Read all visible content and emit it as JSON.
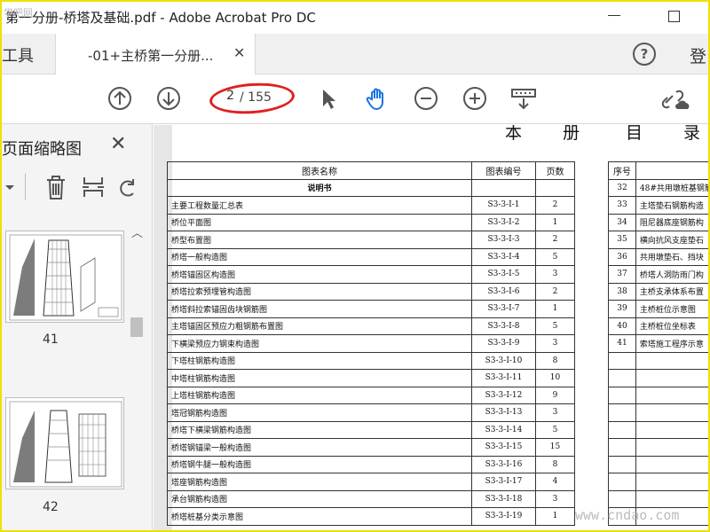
{
  "window": {
    "title": "第一分册-桥塔及基础.pdf - Adobe Acrobat Pro DC",
    "watermark_top": "学吧网"
  },
  "tabs": {
    "tools_label": "工具",
    "doc_tab_label": "-01+主桥第一分册...",
    "signin_label": "登"
  },
  "toolbar": {
    "current_page": "2",
    "total_pages": "/ 155"
  },
  "sidebar": {
    "title": "页面缩略图",
    "thumbnails": [
      {
        "number": "41"
      },
      {
        "number": "42"
      }
    ]
  },
  "document": {
    "heading_chars": [
      "本",
      "册",
      "目",
      "录"
    ],
    "left_table": {
      "headers": [
        "图表名称",
        "图表编号",
        "页数"
      ],
      "section_label": "说明书",
      "rows": [
        [
          "主要工程数量汇总表",
          "S3-3-Ⅰ-1",
          "2"
        ],
        [
          "桥位平面图",
          "S3-3-Ⅰ-2",
          "1"
        ],
        [
          "桥型布置图",
          "S3-3-Ⅰ-3",
          "2"
        ],
        [
          "桥塔一般构造图",
          "S3-3-Ⅰ-4",
          "5"
        ],
        [
          "桥塔锚固区构造图",
          "S3-3-Ⅰ-5",
          "3"
        ],
        [
          "桥塔拉索预埋管构造图",
          "S3-3-Ⅰ-6",
          "2"
        ],
        [
          "桥塔斜拉索锚固齿块钢筋图",
          "S3-3-Ⅰ-7",
          "1"
        ],
        [
          "主塔锚固区预应力粗钢筋布置图",
          "S3-3-Ⅰ-8",
          "5"
        ],
        [
          "下横梁预应力钢束构造图",
          "S3-3-Ⅰ-9",
          "3"
        ],
        [
          "下塔柱钢筋构造图",
          "S3-3-Ⅰ-10",
          "8"
        ],
        [
          "中塔柱钢筋构造图",
          "S3-3-Ⅰ-11",
          "10"
        ],
        [
          "上塔柱钢筋构造图",
          "S3-3-Ⅰ-12",
          "9"
        ],
        [
          "塔冠钢筋构造图",
          "S3-3-Ⅰ-13",
          "3"
        ],
        [
          "桥塔下横梁钢筋构造图",
          "S3-3-Ⅰ-14",
          "5"
        ],
        [
          "桥塔钢锚梁一般构造图",
          "S3-3-Ⅰ-15",
          "15"
        ],
        [
          "桥塔钢牛腿一般构造图",
          "S3-3-Ⅰ-16",
          "8"
        ],
        [
          "塔座钢筋构造图",
          "S3-3-Ⅰ-17",
          "4"
        ],
        [
          "承台钢筋构造图",
          "S3-3-Ⅰ-18",
          "3"
        ],
        [
          "桥塔桩基分类示意图",
          "S3-3-Ⅰ-19",
          "1"
        ]
      ]
    },
    "right_table": {
      "headers": [
        "序号",
        ""
      ],
      "rows": [
        [
          "32",
          "48#共用墩桩基钢筋"
        ],
        [
          "33",
          "主塔垫石钢筋构造"
        ],
        [
          "34",
          "阻尼器底座钢筋构"
        ],
        [
          "35",
          "横向抗风支座垫石"
        ],
        [
          "36",
          "共用墩垫石、挡块"
        ],
        [
          "37",
          "桥塔人洞防雨门构"
        ],
        [
          "38",
          "主桥支承体系布置"
        ],
        [
          "39",
          "主桥桩位示意图"
        ],
        [
          "40",
          "主桥桩位坐标表"
        ],
        [
          "41",
          "索塔施工程序示意"
        ],
        [
          "",
          ""
        ],
        [
          "",
          ""
        ],
        [
          "",
          ""
        ],
        [
          "",
          ""
        ],
        [
          "",
          ""
        ],
        [
          "",
          ""
        ],
        [
          "",
          ""
        ],
        [
          "",
          ""
        ],
        [
          "",
          ""
        ],
        [
          "",
          ""
        ]
      ]
    },
    "watermark": "www.cndao.com"
  }
}
